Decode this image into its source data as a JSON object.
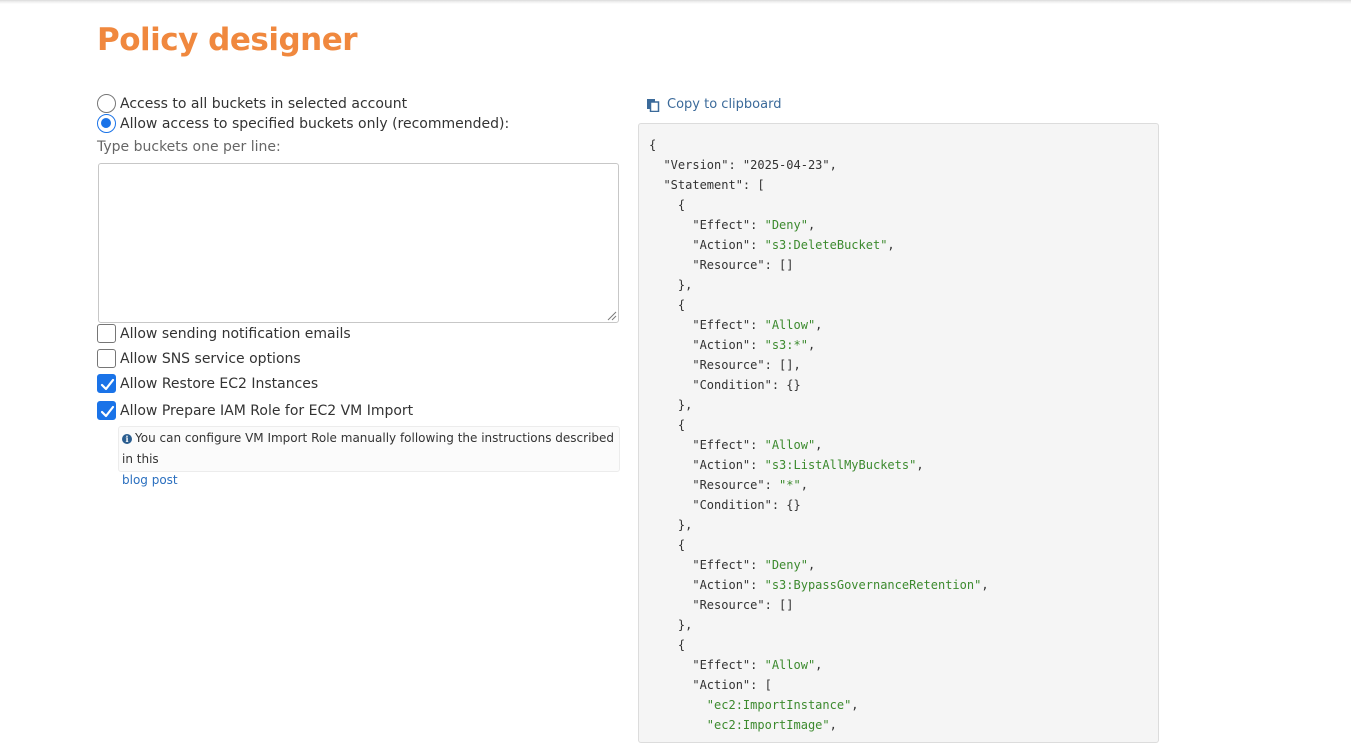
{
  "page": {
    "title": "Policy designer"
  },
  "access": {
    "option_all": "Access to all buckets in selected account",
    "option_specified": "Allow access to specified buckets only (recommended):",
    "selected": "specified"
  },
  "buckets": {
    "label": "Type buckets one per line:",
    "value": ""
  },
  "options": {
    "notification_emails": {
      "label": "Allow sending notification emails",
      "checked": false
    },
    "sns_service": {
      "label": "Allow SNS service options",
      "checked": false
    },
    "restore_ec2": {
      "label": "Allow Restore EC2 Instances",
      "checked": true
    },
    "prepare_iam": {
      "label": "Allow Prepare IAM Role for EC2 VM Import",
      "checked": true
    }
  },
  "info": {
    "text": "You can configure VM Import Role manually following the instructions described in this",
    "link_text": "blog post"
  },
  "clipboard": {
    "label": "Copy to clipboard"
  },
  "policy": {
    "lines": [
      [
        {
          "t": "{",
          "s": false
        }
      ],
      [
        {
          "t": "  \"Version\": ",
          "s": false
        },
        {
          "t": "\"2025-04-23\"",
          "s": false
        },
        {
          "t": ",",
          "s": false
        }
      ],
      [
        {
          "t": "  \"Statement\": [",
          "s": false
        }
      ],
      [
        {
          "t": "    {",
          "s": false
        }
      ],
      [
        {
          "t": "      \"Effect\": ",
          "s": false
        },
        {
          "t": "\"Deny\"",
          "s": true
        },
        {
          "t": ",",
          "s": false
        }
      ],
      [
        {
          "t": "      \"Action\": ",
          "s": false
        },
        {
          "t": "\"s3:DeleteBucket\"",
          "s": true
        },
        {
          "t": ",",
          "s": false
        }
      ],
      [
        {
          "t": "      \"Resource\": []",
          "s": false
        }
      ],
      [
        {
          "t": "    },",
          "s": false
        }
      ],
      [
        {
          "t": "    {",
          "s": false
        }
      ],
      [
        {
          "t": "      \"Effect\": ",
          "s": false
        },
        {
          "t": "\"Allow\"",
          "s": true
        },
        {
          "t": ",",
          "s": false
        }
      ],
      [
        {
          "t": "      \"Action\": ",
          "s": false
        },
        {
          "t": "\"s3:*\"",
          "s": true
        },
        {
          "t": ",",
          "s": false
        }
      ],
      [
        {
          "t": "      \"Resource\": [],",
          "s": false
        }
      ],
      [
        {
          "t": "      \"Condition\": {}",
          "s": false
        }
      ],
      [
        {
          "t": "    },",
          "s": false
        }
      ],
      [
        {
          "t": "    {",
          "s": false
        }
      ],
      [
        {
          "t": "      \"Effect\": ",
          "s": false
        },
        {
          "t": "\"Allow\"",
          "s": true
        },
        {
          "t": ",",
          "s": false
        }
      ],
      [
        {
          "t": "      \"Action\": ",
          "s": false
        },
        {
          "t": "\"s3:ListAllMyBuckets\"",
          "s": true
        },
        {
          "t": ",",
          "s": false
        }
      ],
      [
        {
          "t": "      \"Resource\": ",
          "s": false
        },
        {
          "t": "\"*\"",
          "s": true
        },
        {
          "t": ",",
          "s": false
        }
      ],
      [
        {
          "t": "      \"Condition\": {}",
          "s": false
        }
      ],
      [
        {
          "t": "    },",
          "s": false
        }
      ],
      [
        {
          "t": "    {",
          "s": false
        }
      ],
      [
        {
          "t": "      \"Effect\": ",
          "s": false
        },
        {
          "t": "\"Deny\"",
          "s": true
        },
        {
          "t": ",",
          "s": false
        }
      ],
      [
        {
          "t": "      \"Action\": ",
          "s": false
        },
        {
          "t": "\"s3:BypassGovernanceRetention\"",
          "s": true
        },
        {
          "t": ",",
          "s": false
        }
      ],
      [
        {
          "t": "      \"Resource\": []",
          "s": false
        }
      ],
      [
        {
          "t": "    },",
          "s": false
        }
      ],
      [
        {
          "t": "    {",
          "s": false
        }
      ],
      [
        {
          "t": "      \"Effect\": ",
          "s": false
        },
        {
          "t": "\"Allow\"",
          "s": true
        },
        {
          "t": ",",
          "s": false
        }
      ],
      [
        {
          "t": "      \"Action\": [",
          "s": false
        }
      ],
      [
        {
          "t": "        ",
          "s": false
        },
        {
          "t": "\"ec2:ImportInstance\"",
          "s": true
        },
        {
          "t": ",",
          "s": false
        }
      ],
      [
        {
          "t": "        ",
          "s": false
        },
        {
          "t": "\"ec2:ImportImage\"",
          "s": true
        },
        {
          "t": ",",
          "s": false
        }
      ]
    ]
  },
  "colors": {
    "title": "#f0883e",
    "accent": "#1a73e8",
    "link": "#2a6fbf",
    "code_string": "#3c8a2e",
    "code_background": "#f5f5f5"
  },
  "icons": {
    "copy": "copy-icon",
    "info": "info-icon",
    "check": "checkmark-icon"
  }
}
